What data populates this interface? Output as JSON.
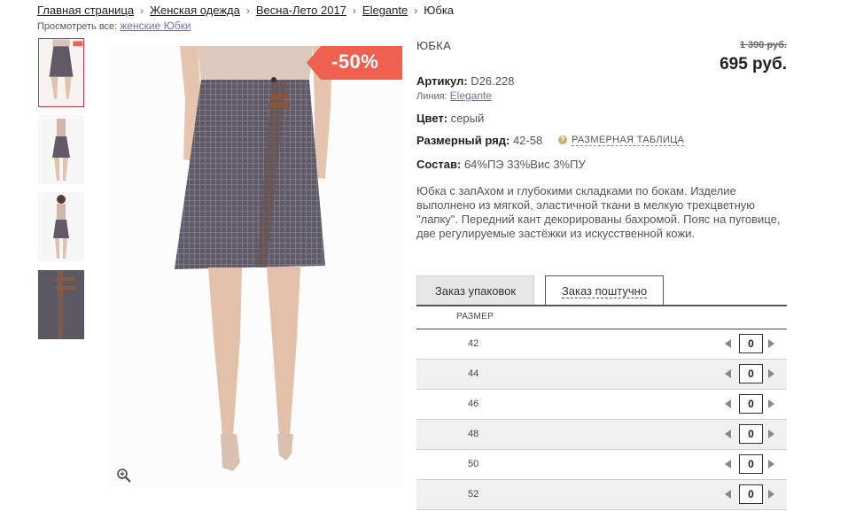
{
  "breadcrumb": {
    "items": [
      "Главная страница",
      "Женская одежда",
      "Весна-Лето 2017",
      "Elegante"
    ],
    "current": "Юбка",
    "separator": "›"
  },
  "view_all": {
    "label": "Просмотреть все:",
    "link": "женские Юбки"
  },
  "gallery": {
    "thumbnails": [
      "skirt-front",
      "model-full-1",
      "model-full-2",
      "fabric-detail"
    ],
    "discount_badge": "-50%"
  },
  "product": {
    "title": "ЮБКА",
    "old_price": "1 390 руб.",
    "price": "695 руб.",
    "article_label": "Артикул:",
    "article_value": "D26.228",
    "line_label": "Линия:",
    "line_value": "Elegante",
    "color_label": "Цвет:",
    "color_value": "серый",
    "size_range_label": "Размерный ряд:",
    "size_range_value": "42-58",
    "size_table_icon": "?",
    "size_table_link": "РАЗМЕРНАЯ ТАБЛИЦА",
    "composition_label": "Состав:",
    "composition_value": "64%ПЭ 33%Вис 3%ПУ",
    "description": "Юбка с запАхом и глубокими складками по бокам. Изделие  выполнено из мягкой, эластичной ткани в мелкую трехцветную \"лапку\". Передний кант декорированы бахромой. Пояс на пуговице, две регулируемые застёжки из искусственной кожи."
  },
  "tabs": [
    {
      "label": "Заказ упаковок",
      "active": false
    },
    {
      "label": "Заказ поштучно",
      "active": true
    }
  ],
  "size_table": {
    "header": "РАЗМЕР",
    "rows": [
      {
        "size": "42",
        "qty": "0"
      },
      {
        "size": "44",
        "qty": "0"
      },
      {
        "size": "46",
        "qty": "0"
      },
      {
        "size": "48",
        "qty": "0"
      },
      {
        "size": "50",
        "qty": "0"
      },
      {
        "size": "52",
        "qty": "0"
      }
    ]
  },
  "colors": {
    "discount": "#f0604f",
    "link": "#7a6fa8",
    "active_thumb_border": "#c9374a"
  }
}
